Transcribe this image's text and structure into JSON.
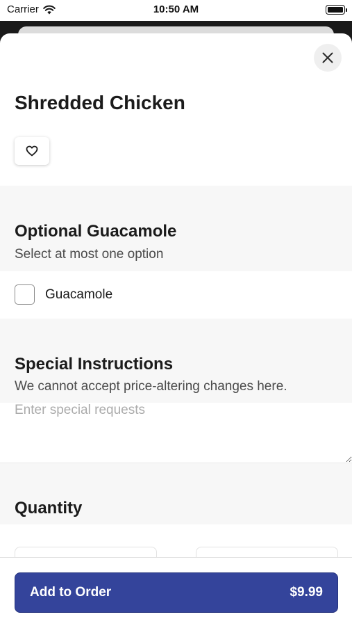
{
  "status_bar": {
    "carrier": "Carrier",
    "time": "10:50 AM"
  },
  "item": {
    "title": "Shredded Chicken"
  },
  "sections": {
    "guacamole": {
      "title": "Optional Guacamole",
      "subtitle": "Select at most one option",
      "options": [
        {
          "label": "Guacamole",
          "checked": false
        }
      ]
    },
    "instructions": {
      "title": "Special Instructions",
      "subtitle": "We cannot accept price-altering changes here.",
      "placeholder": "Enter special requests"
    },
    "quantity": {
      "title": "Quantity"
    }
  },
  "footer": {
    "add_label": "Add to Order",
    "price": "$9.99"
  },
  "colors": {
    "accent": "#34449b",
    "section_bg": "#f7f7f7"
  },
  "icons": [
    "wifi-icon",
    "battery-icon",
    "close-icon",
    "heart-icon"
  ]
}
